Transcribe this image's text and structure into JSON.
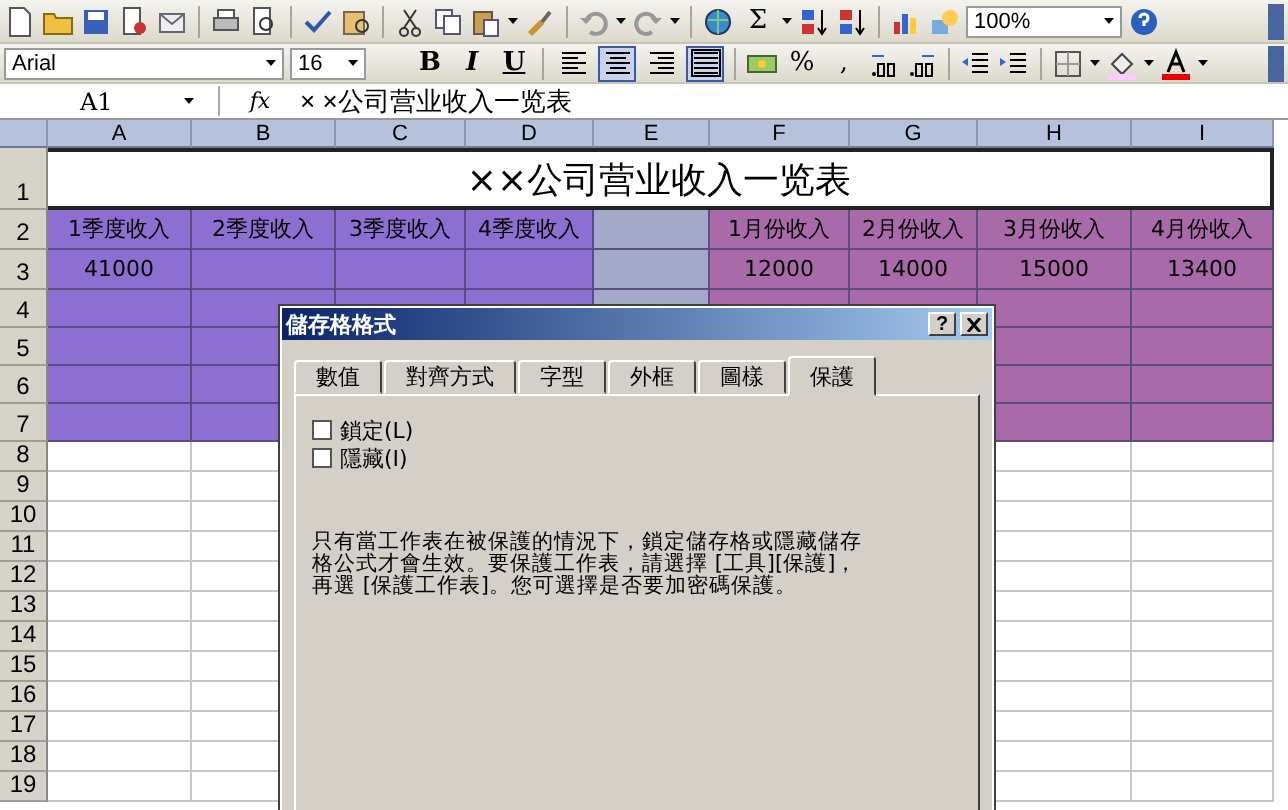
{
  "toolbar": {
    "sum_label": "Σ",
    "zoom": "100%",
    "font": "Arial",
    "font_size": "16",
    "format_buttons": [
      {
        "label": "B",
        "kind": "bold"
      },
      {
        "label": "I",
        "kind": "italic"
      },
      {
        "label": "U",
        "kind": "underline"
      }
    ],
    "align_buttons": [
      {
        "kind": "left",
        "selected": false
      },
      {
        "kind": "center",
        "selected": true
      },
      {
        "kind": "right",
        "selected": false
      },
      {
        "kind": "merge",
        "selected": true
      }
    ],
    "percent_label": "%",
    "comma_label": ","
  },
  "formula_bar": {
    "name_box": "A1",
    "fx": "fx",
    "formula": "× ×公司营业收入一览表"
  },
  "columns": [
    {
      "label": "A",
      "color": "#8c6fd0"
    },
    {
      "label": "B",
      "color": "#8c6fd0"
    },
    {
      "label": "C",
      "color": "#8c6fd0"
    },
    {
      "label": "D",
      "color": "#8c6fd0"
    },
    {
      "label": "E",
      "color": "#a4a9c9"
    },
    {
      "label": "F",
      "color": "#a96aaa"
    },
    {
      "label": "G",
      "color": "#a96aaa"
    },
    {
      "label": "H",
      "color": "#a96aaa"
    },
    {
      "label": "I",
      "color": "#a96aaa"
    }
  ],
  "rows": [
    {
      "label": "1",
      "filled": false,
      "title": "××公司营业收入一览表"
    },
    {
      "label": "2",
      "filled": true,
      "cells": {
        "A": "1季度收入",
        "B": "2季度收入",
        "C": "3季度收入",
        "D": "4季度收入",
        "F": "1月份收入",
        "G": "2月份收入",
        "H": "3月份收入",
        "I": "4月份收入"
      }
    },
    {
      "label": "3",
      "filled": true,
      "cells": {
        "A": "41000",
        "F": "12000",
        "G": "14000",
        "H": "15000",
        "I": "13400"
      }
    },
    {
      "label": "4",
      "filled": true
    },
    {
      "label": "5",
      "filled": true
    },
    {
      "label": "6",
      "filled": true
    },
    {
      "label": "7",
      "filled": true
    },
    {
      "label": "8",
      "filled": false
    },
    {
      "label": "9",
      "filled": false
    },
    {
      "label": "10",
      "filled": false
    },
    {
      "label": "11",
      "filled": false
    },
    {
      "label": "12",
      "filled": false
    },
    {
      "label": "13",
      "filled": false
    },
    {
      "label": "14",
      "filled": false
    },
    {
      "label": "15",
      "filled": false
    },
    {
      "label": "16",
      "filled": false
    },
    {
      "label": "17",
      "filled": false
    },
    {
      "label": "18",
      "filled": false
    },
    {
      "label": "19",
      "filled": false
    }
  ],
  "dialog": {
    "title": "儲存格格式",
    "help": "?",
    "tabs": [
      {
        "label": "數值",
        "selected": false
      },
      {
        "label": "對齊方式",
        "selected": false
      },
      {
        "label": "字型",
        "selected": false
      },
      {
        "label": "外框",
        "selected": false
      },
      {
        "label": "圖樣",
        "selected": false
      },
      {
        "label": "保護",
        "selected": true
      }
    ],
    "checkboxes": [
      {
        "label": "鎖定(L)",
        "checked": false
      },
      {
        "label": "隱藏(I)",
        "checked": false
      }
    ],
    "note_lines": [
      "只有當工作表在被保護的情況下，鎖定儲存格或隱藏儲存",
      "格公式才會生效。要保護工作表，請選擇 [工具][保護]，",
      "再選 [保護工作表]。您可選擇是否要加密碼保護。"
    ]
  }
}
